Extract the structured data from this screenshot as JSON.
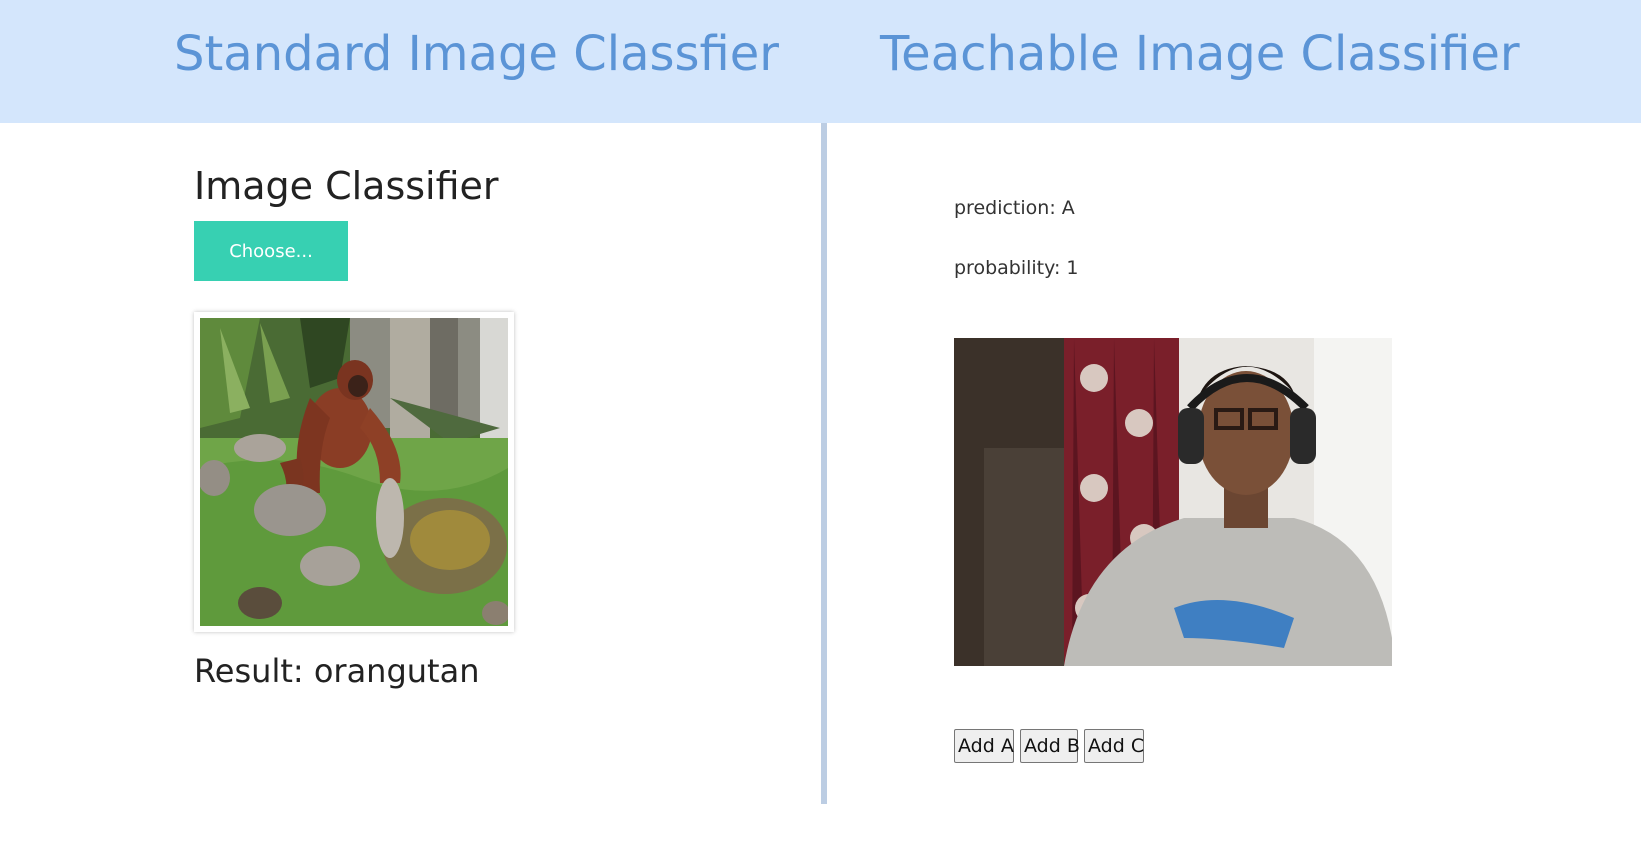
{
  "header": {
    "left_title": "Standard Image Classfier",
    "right_title": "Teachable Image Classifier"
  },
  "standard": {
    "heading": "Image Classifier",
    "choose_label": "Choose...",
    "result_text": "Result: orangutan"
  },
  "teachable": {
    "prediction_text": "prediction: A",
    "probability_text": "probability: 1",
    "buttons": {
      "add_a": "Add A",
      "add_b": "Add B",
      "add_c": "Add C"
    }
  },
  "colors": {
    "header_bg": "#d4e6fc",
    "header_text": "#5b94d6",
    "choose_button": "#37d0b2",
    "divider": "#bccde3"
  }
}
